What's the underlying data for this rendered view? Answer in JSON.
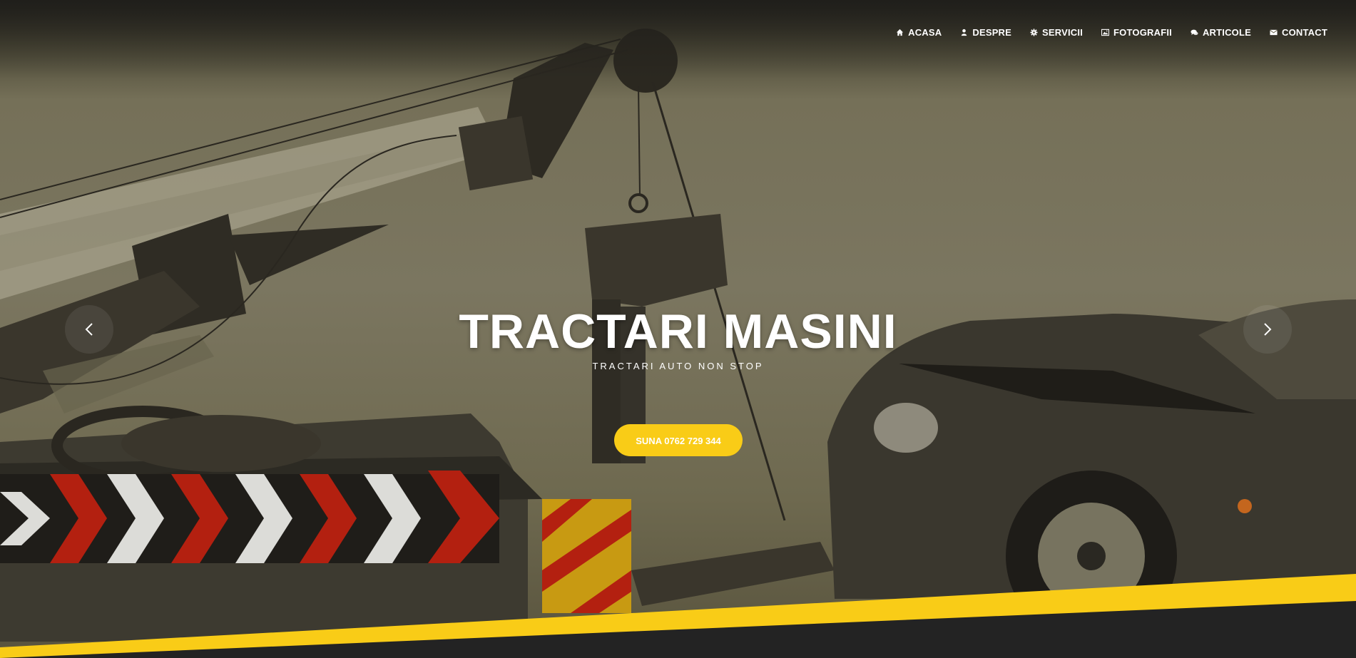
{
  "nav": {
    "items": [
      {
        "label": "ACASA",
        "icon": "home-icon"
      },
      {
        "label": "DESPRE",
        "icon": "user-icon"
      },
      {
        "label": "SERVICII",
        "icon": "gear-icon"
      },
      {
        "label": "FOTOGRAFII",
        "icon": "picture-icon"
      },
      {
        "label": "ARTICOLE",
        "icon": "comments-icon"
      },
      {
        "label": "CONTACT",
        "icon": "envelope-icon"
      }
    ]
  },
  "hero": {
    "title": "TRACTARI MASINI",
    "subtitle": "TRACTARI AUTO NON STOP",
    "cta_label": "SUNA 0762 729 344",
    "prev_icon": "chevron-left-icon",
    "next_icon": "chevron-right-icon"
  },
  "colors": {
    "accent": "#f9cc17",
    "dark_band": "#232323",
    "text": "#ffffff"
  }
}
